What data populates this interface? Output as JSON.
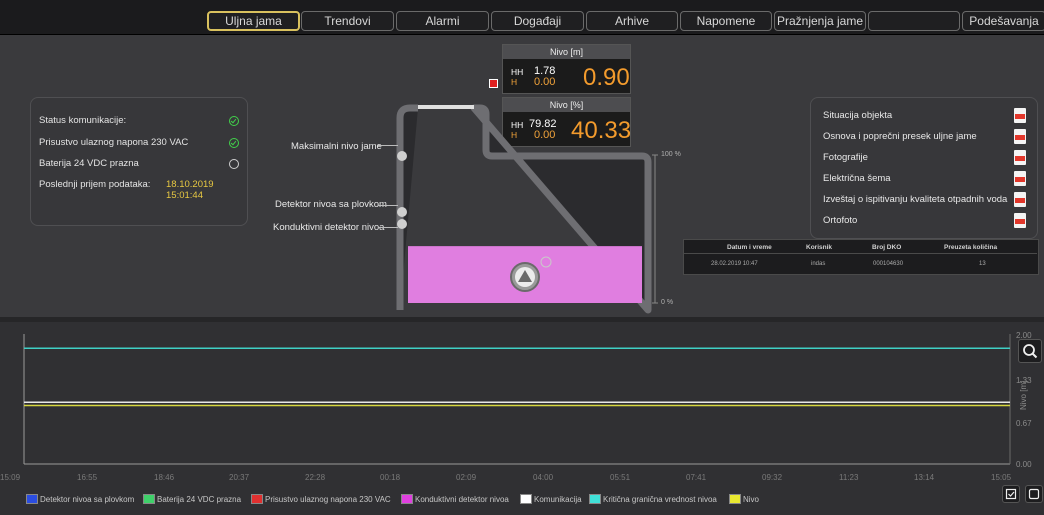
{
  "tabs": [
    "Uljna jama",
    "Trendovi",
    "Alarmi",
    "Događaji",
    "Arhive",
    "Napomene",
    "Pražnjenja jame",
    "",
    "Podešavanja"
  ],
  "status": {
    "rows": [
      "Status komunikacije:",
      "Prisustvo ulaznog napona 230 VAC",
      "Baterija 24 VDC prazna",
      "Poslednji prijem podataka:"
    ],
    "last_receive_value": "18.10.2019 15:01:44"
  },
  "level_m": {
    "title": "Nivo [m]",
    "hh_label": "HH",
    "h_label": "H",
    "hh": "1.78",
    "h": "0.00",
    "value": "0.90"
  },
  "level_pct": {
    "title": "Nivo [%]",
    "hh_label": "HH",
    "h_label": "H",
    "hh": "79.82",
    "h": "0.00",
    "value": "40.33",
    "fill_fraction": 0.4033
  },
  "tank": {
    "sensor_max": "Maksimalni nivo jame",
    "sensor_float": "Detektor nivoa sa plovkom",
    "sensor_conductive": "Konduktivni detektor nivoa",
    "scale_top": "100 %",
    "scale_bottom": "0 %"
  },
  "documents": [
    "Situacija objekta",
    "Osnova i poprečni presek uljne jame",
    "Fotografije",
    "Električna šema",
    "Izveštaj o ispitivanju kvaliteta otpadnih voda",
    "Ortofoto"
  ],
  "discharges": {
    "headers": [
      "Datum i vreme",
      "Korisnik",
      "Broj DKO",
      "Preuzeta količina"
    ],
    "rows": [
      [
        "28.02.2019 10:47",
        "indas",
        "000104630",
        "13"
      ]
    ]
  },
  "chart": {
    "x_ticks": [
      "15:09",
      "16:55",
      "18:46",
      "20:37",
      "22:28",
      "00:18",
      "02:09",
      "04:00",
      "05:51",
      "07:41",
      "09:32",
      "11:23",
      "13:14",
      "15:05"
    ],
    "y_ticks": [
      "2.00",
      "1.33",
      "0.67",
      "0.00"
    ],
    "y_label": "Nivo [m]"
  },
  "chart_data": {
    "type": "line",
    "ylim": [
      0,
      2.0
    ],
    "series": [
      {
        "name": "Kritična granična vrednost nivoa",
        "values": [
          1.78,
          1.78
        ],
        "color": "#3fd0c6"
      },
      {
        "name": "Komunikacija",
        "values": [
          0.95,
          0.95
        ],
        "color": "#e8e8e8"
      },
      {
        "name": "Nivo",
        "values": [
          0.9,
          0.9
        ],
        "color": "#d8d840"
      }
    ]
  },
  "legend": [
    {
      "label": "Detektor nivoa sa plovkom",
      "color": "#2b4de0"
    },
    {
      "label": "Baterija 24 VDC prazna",
      "color": "#3fd06a"
    },
    {
      "label": "Prisustvo ulaznog napona 230 VAC",
      "color": "#e03030"
    },
    {
      "label": "Konduktivni detektor nivoa",
      "color": "#e040e0"
    },
    {
      "label": "Komunikacija",
      "color": "#ffffff"
    },
    {
      "label": "Kritična granična vrednost nivoa",
      "color": "#40e0d8"
    },
    {
      "label": "Nivo",
      "color": "#e8e830"
    }
  ],
  "colors": {
    "accent": "#d9c15e",
    "liquid": "#e07ee0",
    "value_orange": "#f39b2d"
  },
  "icons": [
    "search-icon",
    "checkbox-icon",
    "square-icon",
    "pump-icon",
    "pdf-icon"
  ]
}
